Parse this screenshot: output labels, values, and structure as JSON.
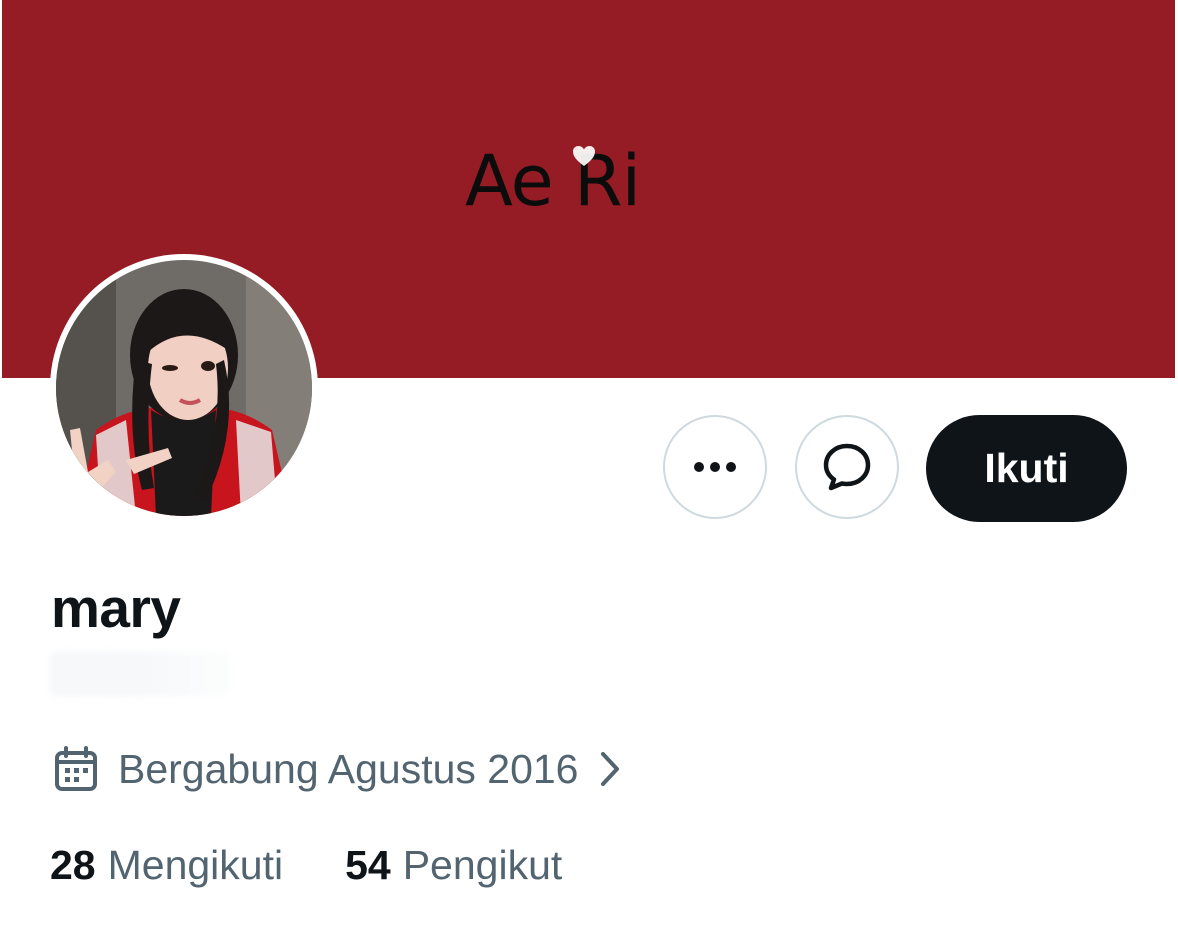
{
  "profile": {
    "banner_text": "Ae Ri",
    "display_name": "mary",
    "joined": "Bergabung Agustus 2016",
    "following_count": "28",
    "following_label": "Mengikuti",
    "followers_count": "54",
    "followers_label": "Pengikut"
  },
  "actions": {
    "more_icon": "more-horizontal-icon",
    "message_icon": "message-bubble-icon",
    "follow_label": "Ikuti"
  },
  "icons": {
    "calendar": "calendar-icon",
    "chevron": "chevron-right-icon",
    "banner_heart": "heart-icon"
  },
  "colors": {
    "banner": "#951c24",
    "follow_button": "#0f1419",
    "secondary_text": "#536471",
    "border": "#cfd9de"
  }
}
